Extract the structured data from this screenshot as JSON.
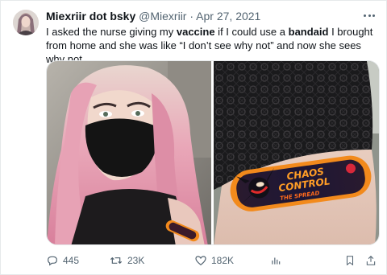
{
  "tweet": {
    "display_name": "Miexriir dot bsky",
    "handle": "@Miexriir",
    "separator": "·",
    "date": "Apr 27, 2021",
    "text_parts": {
      "p1": "I asked the nurse giving my ",
      "b1": "vaccine",
      "p2": " if I could use a ",
      "b2": "bandaid",
      "p3": " I brought from home and she was like “I don’t see why not” and now she sees why not"
    },
    "bandaid_text": {
      "line1": "CHAOS",
      "line2": "CONTROL",
      "line3": "THE SPREAD"
    }
  },
  "actions": {
    "replies": "445",
    "retweets": "23K",
    "likes": "182K"
  },
  "icons": {
    "reply": "reply-icon",
    "retweet": "retweet-icon",
    "like": "heart-icon",
    "views": "analytics-icon",
    "bookmark": "bookmark-icon",
    "share": "share-icon",
    "more": "more-icon"
  },
  "colors": {
    "text": "#0f1419",
    "secondary": "#536471",
    "bandaid_orange": "#f28a1c",
    "hair_pink": "#e9a7b8"
  }
}
